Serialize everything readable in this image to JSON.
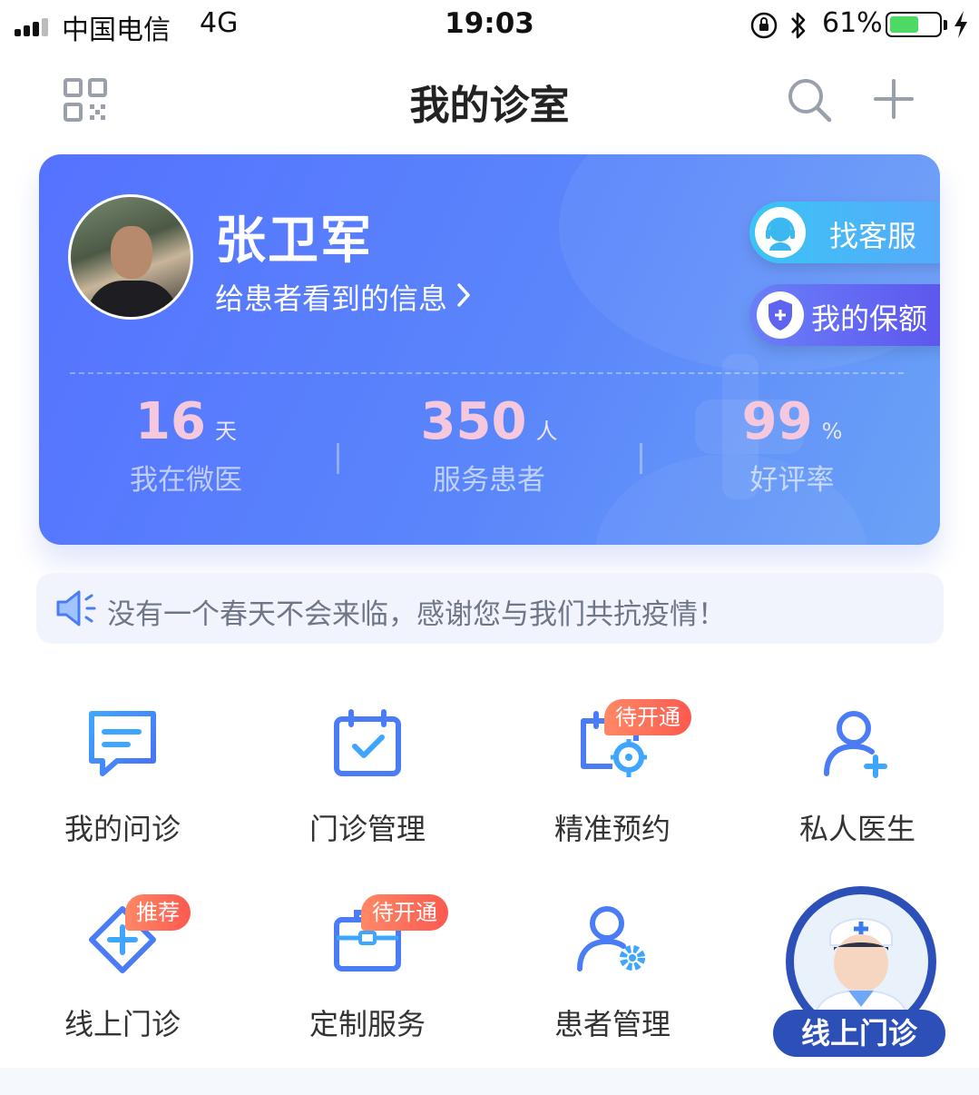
{
  "status_bar": {
    "carrier": "中国电信",
    "network": "4G",
    "time": "19:03",
    "battery_percent": "61%",
    "battery_level": 0.61
  },
  "nav": {
    "title": "我的诊室"
  },
  "profile": {
    "name": "张卫军",
    "info_link": "给患者看到的信息",
    "customer_service": "找客服",
    "my_coverage": "我的保额",
    "stats": [
      {
        "value": "16",
        "unit": "天",
        "label": "我在微医"
      },
      {
        "value": "350",
        "unit": "人",
        "label": "服务患者"
      },
      {
        "value": "99",
        "unit": "%",
        "label": "好评率"
      }
    ]
  },
  "notice": {
    "text": "没有一个春天不会来临，感谢您与我们共抗疫情！"
  },
  "grid": [
    {
      "label": "我的问诊",
      "icon": "chat-icon"
    },
    {
      "label": "门诊管理",
      "icon": "calendar-check-icon"
    },
    {
      "label": "精准预约",
      "icon": "calendar-target-icon",
      "badge": "待开通"
    },
    {
      "label": "私人医生",
      "icon": "person-plus-icon"
    },
    {
      "label": "线上门诊",
      "icon": "diamond-plus-icon",
      "badge": "推荐"
    },
    {
      "label": "定制服务",
      "icon": "briefcase-icon",
      "badge": "待开通"
    },
    {
      "label": "患者管理",
      "icon": "person-gear-icon"
    }
  ],
  "fab": {
    "label": "线上门诊"
  },
  "colors": {
    "accent_blue": "#4a7cf6",
    "badge_red": "#fb5a4f",
    "card_blue": "#5572ff"
  }
}
